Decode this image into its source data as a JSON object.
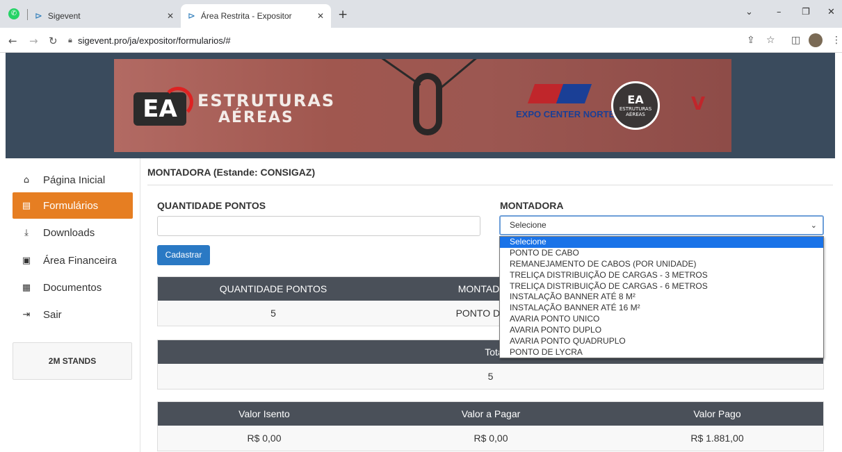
{
  "browser": {
    "tabs": [
      {
        "label": "Sigevent",
        "active": false
      },
      {
        "label": "Área Restrita - Expositor",
        "active": true
      }
    ],
    "url": "sigevent.pro/ja/expositor/formularios/#"
  },
  "banner": {
    "brand_line1": "ESTRUTURAS",
    "brand_line2": "AÉREAS",
    "logo_text": "EA",
    "venue": "EXPO CENTER NORTE",
    "badge_text": "ESTRUTURAS AÉREAS"
  },
  "sidebar": {
    "items": [
      {
        "label": "Página Inicial",
        "icon": "home-icon"
      },
      {
        "label": "Formulários",
        "icon": "form-icon",
        "active": true
      },
      {
        "label": "Downloads",
        "icon": "download-icon"
      },
      {
        "label": "Área Financeira",
        "icon": "money-icon"
      },
      {
        "label": "Documentos",
        "icon": "document-icon"
      },
      {
        "label": "Sair",
        "icon": "logout-icon"
      }
    ],
    "stands": "2M STANDS"
  },
  "form": {
    "title": "MONTADORA (Estande: CONSIGAZ)",
    "qty_label": "QUANTIDADE PONTOS",
    "qty_value": "",
    "montadora_label": "MONTADORA",
    "montadora_selected": "Selecione",
    "submit_label": "Cadastrar",
    "options": [
      "Selecione",
      "PONTO DE CABO",
      "REMANEJAMENTO DE CABOS (POR UNIDADE)",
      "TRELIÇA DISTRIBUIÇÃO DE CARGAS - 3 METROS",
      "TRELIÇA DISTRIBUIÇÃO DE CARGAS - 6 METROS",
      "INSTALAÇÃO BANNER ATÉ 8 M²",
      "INSTALAÇÃO BANNER ATÉ 16 M²",
      "AVARIA PONTO UNICO",
      "AVARIA PONTO DUPLO",
      "AVARIA PONTO QUADRUPLO",
      "PONTO DE LYCRA"
    ]
  },
  "table1": {
    "headers": [
      "QUANTIDADE PONTOS",
      "MONTADOR"
    ],
    "row": [
      "5",
      "PONTO DE C"
    ]
  },
  "table2": {
    "header": "Tota",
    "value": "5"
  },
  "table3": {
    "headers": [
      "Valor Isento",
      "Valor a Pagar",
      "Valor Pago"
    ],
    "row": [
      "R$ 0,00",
      "R$ 0,00",
      "R$ 1.881,00"
    ]
  }
}
